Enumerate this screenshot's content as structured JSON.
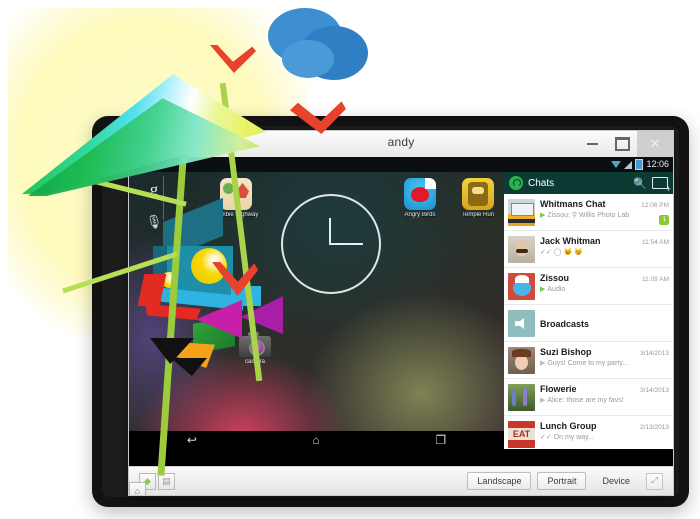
{
  "window": {
    "title": "andy",
    "controls": {
      "minimize": "–",
      "maximize": "▢",
      "close": "✕"
    }
  },
  "android": {
    "status_bar": {
      "time": "12:06",
      "icons": [
        "wifi-icon",
        "signal-icon",
        "battery-icon"
      ]
    },
    "home_screen": {
      "search_widget": {
        "google_letter": "g",
        "mic_icon": "🎙"
      },
      "apps": [
        {
          "label": "Zombie Highway",
          "icon": "zombie-highway-icon"
        },
        {
          "label": "Angry Birds",
          "icon": "angry-birds-icon"
        },
        {
          "label": "Temple Run",
          "icon": "temple-run-icon"
        }
      ],
      "clock_widget": "analog-clock",
      "mascot_label": "camera"
    },
    "nav_bar": {
      "back": "↩",
      "home": "⌂",
      "recents": "❐"
    }
  },
  "whatsapp": {
    "header": {
      "title": "Chats",
      "logo": "whatsapp-icon",
      "search_icon": "search-icon",
      "compose_icon": "new-chat-icon"
    },
    "chats": [
      {
        "name": "Whitmans Chat",
        "time": "12:06 PM",
        "preview": "Zissou: ⚲ Willis Photo Lab",
        "has_play": true,
        "badge": "1",
        "avatar": "train-avatar"
      },
      {
        "name": "Jack Whitman",
        "time": "11:54 AM",
        "preview": "✓✓ ◯ 😺 😸",
        "has_play": false,
        "badge": "",
        "avatar": "man-avatar"
      },
      {
        "name": "Zissou",
        "time": "11:09 AM",
        "preview": "Audio",
        "has_play": true,
        "badge": "",
        "avatar": "cartoon-avatar"
      },
      {
        "name": "Broadcasts",
        "time": "",
        "preview": "",
        "has_play": false,
        "badge": "",
        "avatar": "megaphone-avatar"
      },
      {
        "name": "Suzi Bishop",
        "time": "3/14/2013",
        "preview": "Guys! Come to my party...",
        "has_play": true,
        "badge": "",
        "avatar": "woman-avatar"
      },
      {
        "name": "Flowerie",
        "time": "3/14/2013",
        "preview": "Alice: those are my favs!",
        "has_play": true,
        "badge": "",
        "avatar": "flowers-avatar"
      },
      {
        "name": "Lunch Group",
        "time": "2/13/2013",
        "preview": "✓✓ On my way...",
        "has_play": false,
        "badge": "",
        "avatar": "eat-sign-avatar"
      }
    ]
  },
  "toolbar": {
    "back_icon": "◆",
    "home_icon": "⌂",
    "menu_icon": "▤",
    "landscape_label": "Landscape",
    "portrait_label": "Portrait",
    "device_label": "Device",
    "fullscreen_icon": "⤢"
  },
  "colors": {
    "whatsapp_green": "#2bb24c",
    "header_dark": "#0b3b33",
    "badge_green": "#8bc832",
    "glow_yellow": "#fdfabb",
    "chevron_red": "#e8412c",
    "cloud_blue": "#3d8fd1",
    "stalk_green": "#9ccb3b"
  }
}
